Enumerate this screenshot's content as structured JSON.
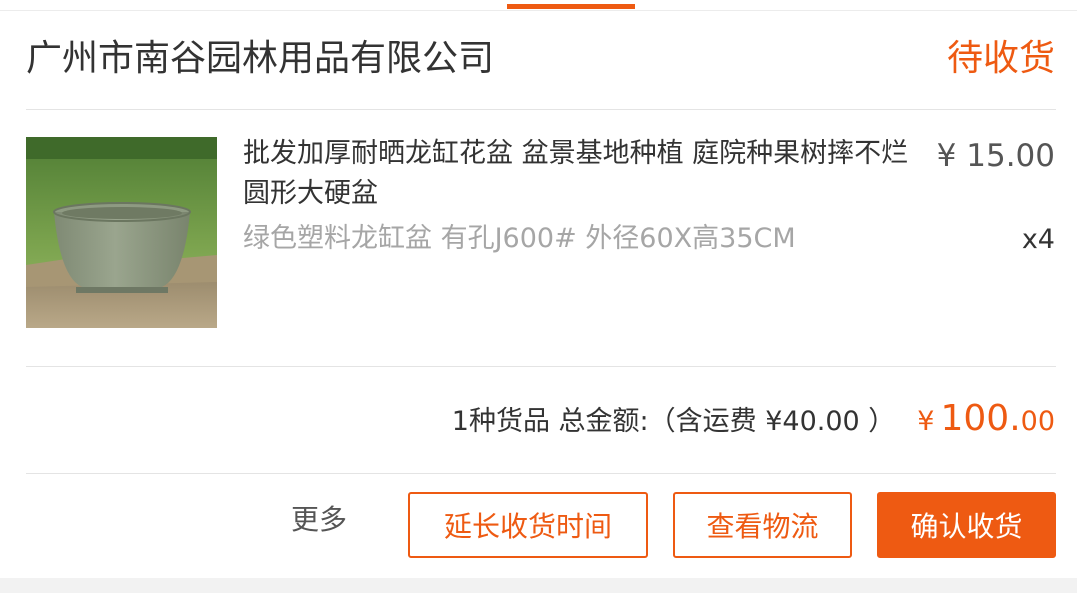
{
  "order": {
    "shop_name": "广州市南谷园林用品有限公司",
    "status": "待收货"
  },
  "product": {
    "image_icon": "product-photo-green-plastic-planter",
    "title": "批发加厚耐晒龙缸花盆 盆景基地种植 庭院种果树摔不烂圆形大硬盆",
    "sku": "绿色塑料龙缸盆 有孔J600# 外径60X高35CM",
    "price": "¥ 15.00",
    "quantity": "x4"
  },
  "summary": {
    "text": "1种货品 总金额:（含运费 ¥40.00 ）",
    "total_symbol": "¥",
    "total_integer": "100.",
    "total_decimal": "00"
  },
  "actions": {
    "more": "更多",
    "extend_receipt": "延长收货时间",
    "view_logistics": "查看物流",
    "confirm_receipt": "确认收货"
  },
  "colors": {
    "accent": "#ee5a12",
    "text_primary": "#333333",
    "text_secondary": "#a6a6a6"
  }
}
